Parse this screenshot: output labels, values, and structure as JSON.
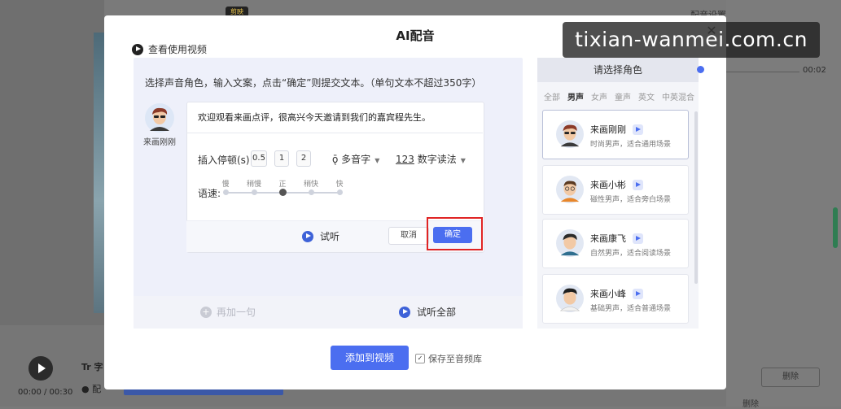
{
  "background": {
    "top_chip": "剪映",
    "right_title": "配音设置",
    "right_time": "00:02",
    "time": "00:00 / 00:30",
    "label_subtitle": "Tr 字",
    "label_dub": "● 配",
    "right_btn1": "删除",
    "right_btn2": "删除"
  },
  "modal": {
    "title": "AI配音",
    "close_symbol": "✕",
    "howto_label": "查看使用视频",
    "instruction": "选择声音角色，输入文案，点击“确定”则提交文本。（单句文本不超过350字）",
    "selected_voice": "来画刚刚",
    "text_content": "欢迎观看来画点评，很高兴今天邀请到我们的嘉宾程先生。",
    "insert_pause_label": "插入停顿(s)",
    "pause_options": [
      "0.5",
      "1",
      "2"
    ],
    "polyphone_label": "多音字",
    "number_reading_icon": "123",
    "number_reading_label": "数字读法",
    "speed_label": "语速:",
    "speed_options": [
      "慢",
      "稍慢",
      "正",
      "稍快",
      "快"
    ],
    "speed_selected_index": 2,
    "listen_label": "试听",
    "cancel_label": "取消",
    "confirm_label": "确定",
    "add_segment_label": "再加一句",
    "listen_all_label": "试听全部",
    "add_to_video_label": "添加到视频",
    "save_to_library_label": "保存至音频库",
    "save_checked": true
  },
  "voices": {
    "header": "请选择角色",
    "tabs": [
      "全部",
      "男声",
      "女声",
      "童声",
      "英文",
      "中英混合"
    ],
    "active_tab": "男声",
    "items": [
      {
        "name": "来画刚刚",
        "desc": "时尚男声，适合通用场景",
        "selected": true
      },
      {
        "name": "来画小彬",
        "desc": "磁性男声，适合旁白场景",
        "selected": false
      },
      {
        "name": "来画康飞",
        "desc": "自然男声，适合阅读场景",
        "selected": false
      },
      {
        "name": "来画小峰",
        "desc": "基础男声，适合普通场景",
        "selected": false
      }
    ]
  },
  "watermark": "tixian-wanmei.com.cn",
  "colors": {
    "accent": "#4b6ef0",
    "highlight": "#e02424"
  }
}
